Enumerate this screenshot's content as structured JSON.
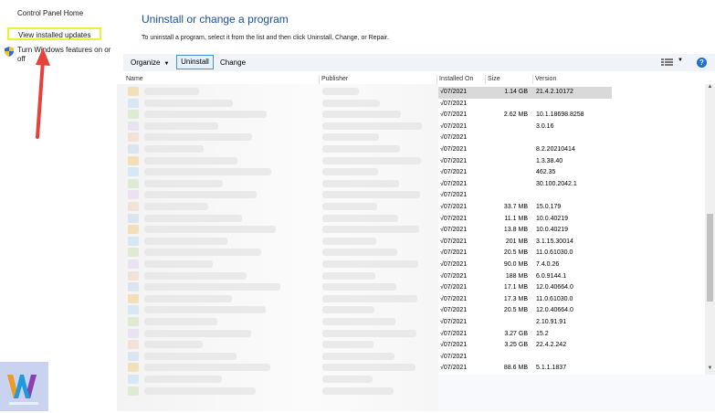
{
  "left_panel": {
    "home_link": "Control Panel Home",
    "updates_link": "View installed updates",
    "features_link": "Turn Windows features on or off"
  },
  "header": {
    "title": "Uninstall or change a program",
    "instructions": "To uninstall a program, select it from the list and then click Uninstall, Change, or Repair."
  },
  "toolbar": {
    "organize_label": "Organize",
    "uninstall_label": "Uninstall",
    "change_label": "Change",
    "help_label": "?"
  },
  "columns": {
    "name": "Name",
    "publisher": "Publisher",
    "installed_on": "Installed On",
    "size": "Size",
    "version": "Version"
  },
  "rows": [
    {
      "installed": "√07/2021",
      "size": "1.14 GB",
      "version": "21.4.2.10172",
      "selected": true
    },
    {
      "installed": "√07/2021",
      "size": "",
      "version": ""
    },
    {
      "installed": "√07/2021",
      "size": "2.62 MB",
      "version": "10.1.18698.8258"
    },
    {
      "installed": "√07/2021",
      "size": "",
      "version": "3.0.16"
    },
    {
      "installed": "√07/2021",
      "size": "",
      "version": ""
    },
    {
      "installed": "√07/2021",
      "size": "",
      "version": "8.2.20210414"
    },
    {
      "installed": "√07/2021",
      "size": "",
      "version": "1.3.38.40"
    },
    {
      "installed": "√07/2021",
      "size": "",
      "version": "462.35"
    },
    {
      "installed": "√07/2021",
      "size": "",
      "version": "30.100.2042.1"
    },
    {
      "installed": "√07/2021",
      "size": "",
      "version": ""
    },
    {
      "installed": "√07/2021",
      "size": "33.7 MB",
      "version": "15.0.179"
    },
    {
      "installed": "√07/2021",
      "size": "11.1 MB",
      "version": "10.0.40219"
    },
    {
      "installed": "√07/2021",
      "size": "13.8 MB",
      "version": "10.0.40219"
    },
    {
      "installed": "√07/2021",
      "size": "201 MB",
      "version": "3.1.15.30014"
    },
    {
      "installed": "√07/2021",
      "size": "20.5 MB",
      "version": "11.0.61030.0"
    },
    {
      "installed": "√07/2021",
      "size": "90.0 MB",
      "version": "7.4.0.26"
    },
    {
      "installed": "√07/2021",
      "size": "188 MB",
      "version": "6.0.9144.1"
    },
    {
      "installed": "√07/2021",
      "size": "17.1 MB",
      "version": "12.0.40664.0"
    },
    {
      "installed": "√07/2021",
      "size": "17.3 MB",
      "version": "11.0.61030.0"
    },
    {
      "installed": "√07/2021",
      "size": "20.5 MB",
      "version": "12.0.40664.0"
    },
    {
      "installed": "√07/2021",
      "size": "",
      "version": "2.10.91.91"
    },
    {
      "installed": "√07/2021",
      "size": "3.27 GB",
      "version": "15.2"
    },
    {
      "installed": "√07/2021",
      "size": "3.25 GB",
      "version": "22.4.2.242"
    },
    {
      "installed": "√07/2021",
      "size": "",
      "version": ""
    },
    {
      "installed": "√07/2021",
      "size": "88.6 MB",
      "version": "5.1.1.1837"
    }
  ],
  "icons": {
    "shield": "uac-shield-icon",
    "arrow": "red-arrow-annotation",
    "view": "view-options-icon",
    "help": "help-icon"
  },
  "colors": {
    "title_blue": "#1c4fa0",
    "highlight": "#e8f23a",
    "arrow": "#e8403a",
    "selected_row": "#d9d9d9",
    "help": "#1f6fd1"
  }
}
